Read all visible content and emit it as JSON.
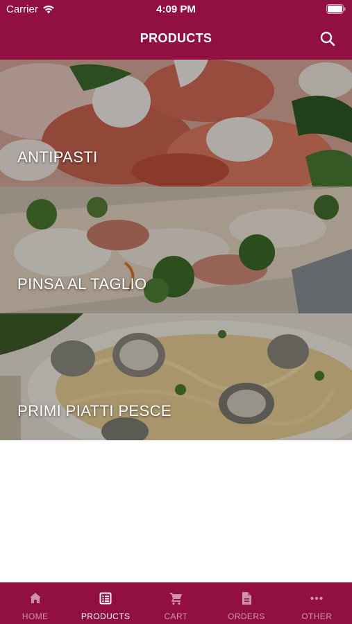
{
  "status_bar": {
    "carrier": "Carrier",
    "time": "4:09 PM"
  },
  "nav": {
    "title": "PRODUCTS",
    "search_icon": "search-icon"
  },
  "categories": [
    {
      "label": "ANTIPASTI",
      "photo": "prosciutto-mozzarella-arugula-photo"
    },
    {
      "label": "PINSA AL TAGLIO",
      "photo": "pinsa-broccoli-photo"
    },
    {
      "label": "PRIMI PIATTI PESCE",
      "photo": "spaghetti-clams-photo"
    }
  ],
  "tabs": [
    {
      "label": "HOME",
      "icon": "home-icon",
      "active": false
    },
    {
      "label": "PRODUCTS",
      "icon": "products-list-icon",
      "active": true
    },
    {
      "label": "CART",
      "icon": "cart-icon",
      "active": false
    },
    {
      "label": "ORDERS",
      "icon": "document-icon",
      "active": false
    },
    {
      "label": "OTHER",
      "icon": "more-dots-icon",
      "active": false
    }
  ],
  "colors": {
    "brand": "#921040",
    "active_tab": "#ffffff",
    "inactive_tab": "rgba(255,255,255,0.55)"
  }
}
